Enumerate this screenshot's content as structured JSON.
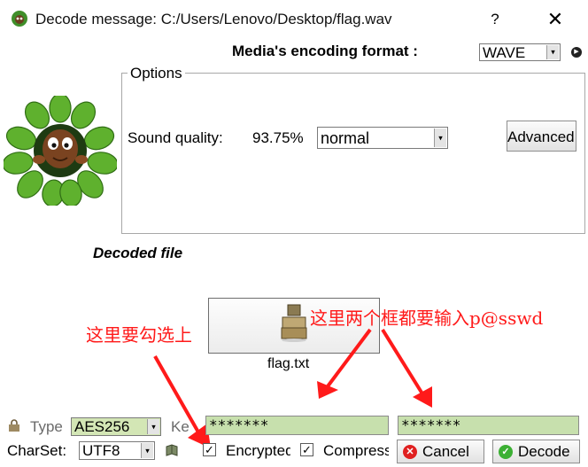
{
  "window": {
    "title": "Decode message: C:/Users/Lenovo/Desktop/flag.wav",
    "help_glyph": "?",
    "close_glyph": "✕"
  },
  "encoding": {
    "label": "Media's encoding format :",
    "value": "WAVE"
  },
  "options": {
    "legend": "Options",
    "sound_quality_label": "Sound quality:",
    "sound_quality_value": "93.75%",
    "quality_select_value": "normal",
    "advanced_button": "Advanced"
  },
  "decoded": {
    "title": "Decoded file",
    "file_name": "flag.txt"
  },
  "annotations": {
    "check_note": "这里要勾选上",
    "password_note": "这里两个框都要输入p@sswd",
    "color": "#ff1a1a"
  },
  "encryption": {
    "type_label": "Type",
    "type_value": "AES256",
    "key_label": "Ke",
    "password_1": "*******",
    "password_2": "*******"
  },
  "footer": {
    "charset_label": "CharSet:",
    "charset_value": "UTF8",
    "encrypted_label": "Encrypted",
    "encrypted_checked": "✓",
    "compress_label": "Compress",
    "compress_checked": "✓",
    "cancel_button": "Cancel",
    "decode_button": "Decode"
  },
  "icons": {
    "app": "mascot-app-icon",
    "mascot": "leaf-mascot",
    "file": "file-box-icon",
    "type": "lock-icon",
    "charset": "book-icon",
    "cancel": "cancel-icon",
    "decode": "check-icon"
  }
}
